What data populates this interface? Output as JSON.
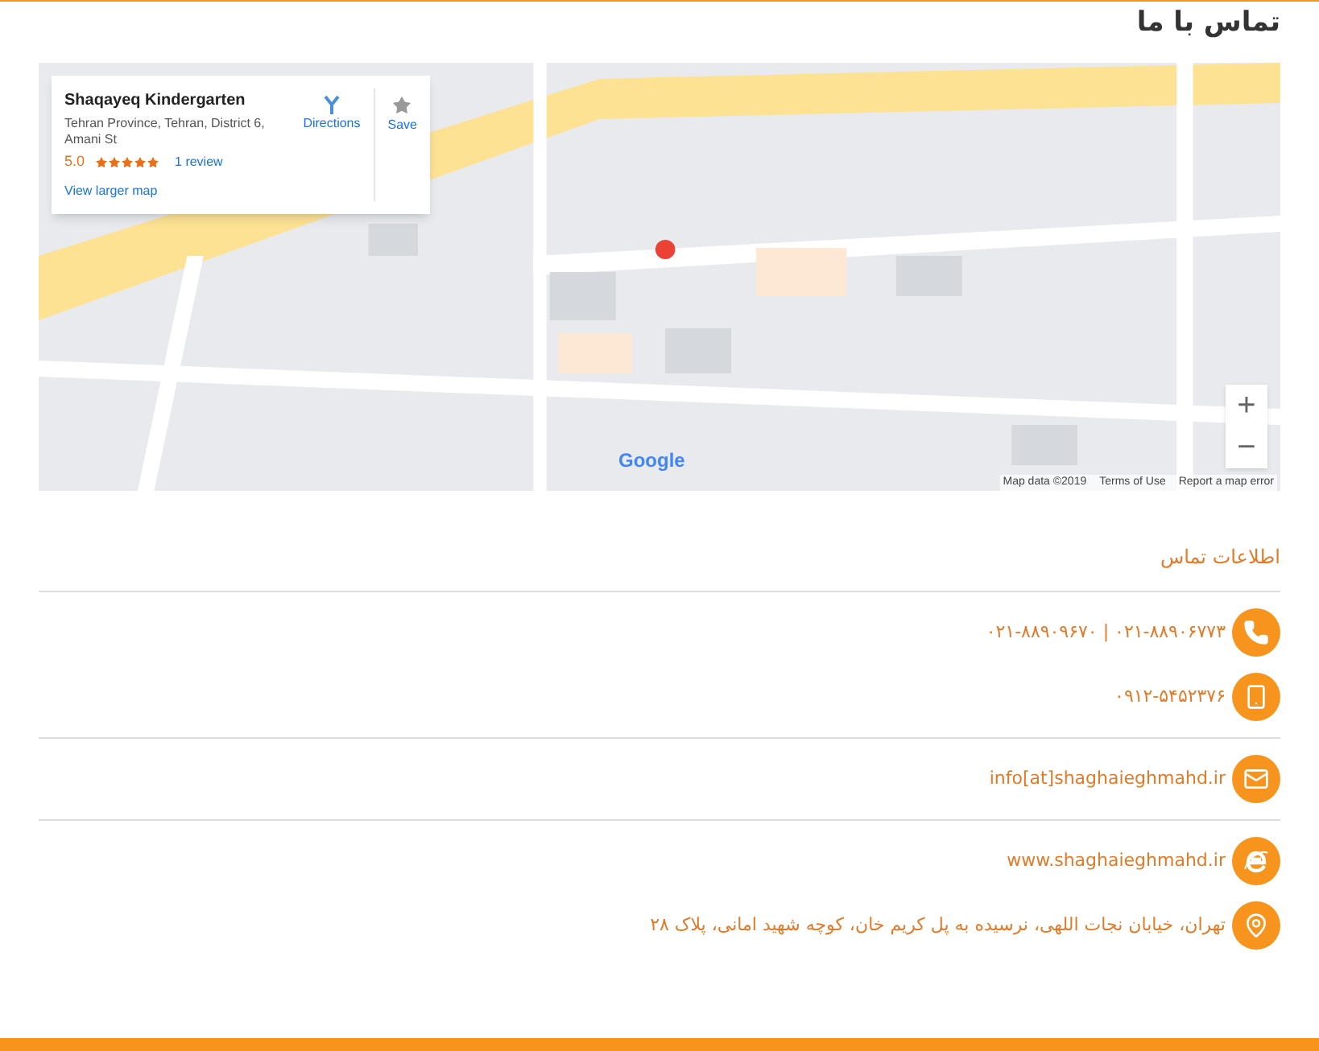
{
  "page_title": "تماس با ما",
  "map": {
    "kind": "picture",
    "place_card": {
      "name": "Shaqayeq Kindergarten",
      "address": "Tehran Province, Tehran, District 6, Amani St",
      "rating": "5.0",
      "stars": 5,
      "reviews": "1 review",
      "directions": "Directions",
      "save": "Save",
      "larger_map": "View larger map"
    },
    "zoom_in": "+",
    "zoom_out": "−",
    "logo": "Google",
    "attribution": [
      "Map data ©2019",
      "Terms of Use",
      "Report a map error"
    ]
  },
  "contact": {
    "heading": "اطلاعات تماس",
    "groups": [
      [
        {
          "kind": "phone",
          "text": "۰۲۱-۸۸۹۰۶۷۷۳ | ۰۲۱-۸۸۹۰۹۶۷۰"
        },
        {
          "kind": "mobile",
          "text": "۰۹۱۲-۵۴۵۲۳۷۶"
        }
      ],
      [
        {
          "kind": "email",
          "text": "info[at]shaghaieghmahd.ir"
        }
      ],
      [
        {
          "kind": "website",
          "text": "www.shaghaieghmahd.ir"
        },
        {
          "kind": "address",
          "text": "تهران، خیابان نجات اللهی، نرسیده به پل کریم خان، کوچه شهید امانی، پلاک ۲۸"
        }
      ]
    ]
  }
}
